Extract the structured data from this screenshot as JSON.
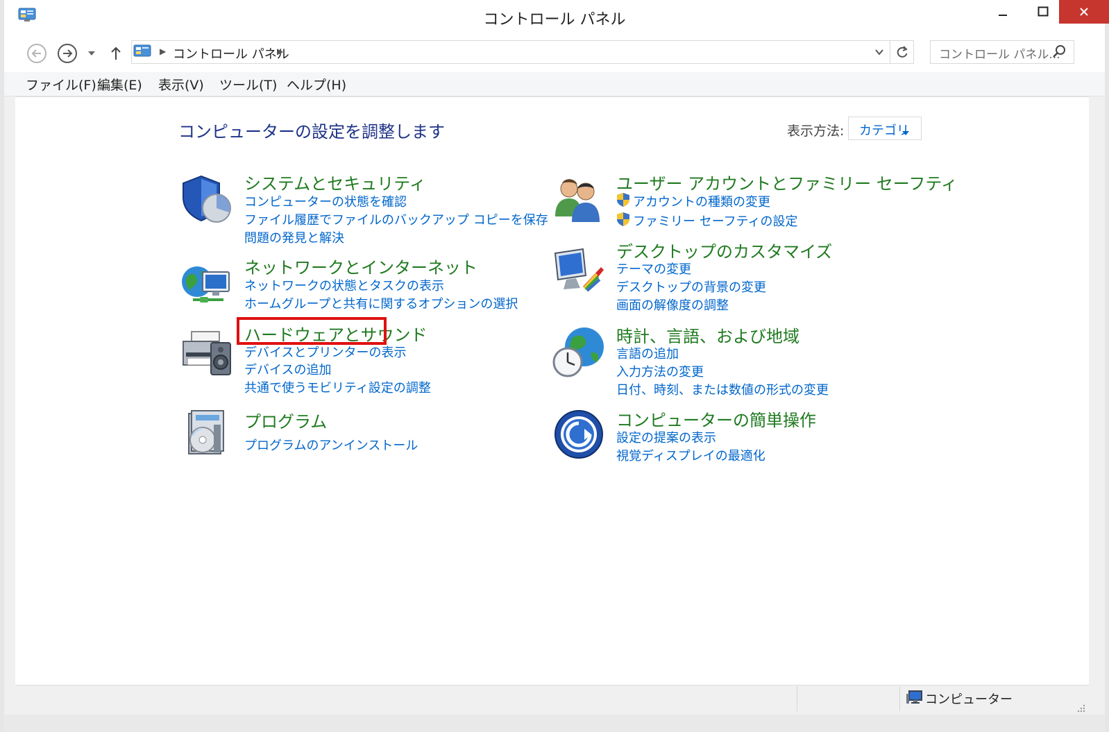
{
  "window": {
    "title": "コントロール パネル",
    "accent_close": "#c7352f"
  },
  "nav": {
    "breadcrumb": "コントロール パネル",
    "search_placeholder": "コントロール パネル..."
  },
  "menu": {
    "items": [
      "ファイル(F)",
      "編集(E)",
      "表示(V)",
      "ツール(T)",
      "ヘルプ(H)"
    ]
  },
  "main": {
    "heading": "コンピューターの設定を調整します",
    "view_by_label": "表示方法:",
    "view_by_value": "カテゴリ",
    "categories": [
      {
        "title": "システムとセキュリティ",
        "icon": "shield-icon",
        "links": [
          "コンピューターの状態を確認",
          "ファイル履歴でファイルのバックアップ コピーを保存",
          "問題の発見と解決"
        ]
      },
      {
        "title": "ネットワークとインターネット",
        "icon": "network-icon",
        "links": [
          "ネットワークの状態とタスクの表示",
          "ホームグループと共有に関するオプションの選択"
        ]
      },
      {
        "title": "ハードウェアとサウンド",
        "icon": "printer-icon",
        "links": [
          "デバイスとプリンターの表示",
          "デバイスの追加",
          "共通で使うモビリティ設定の調整"
        ]
      },
      {
        "title": "プログラム",
        "icon": "programs-icon",
        "links": [
          "プログラムのアンインストール"
        ]
      },
      {
        "title": "ユーザー アカウントとファミリー セーフティ",
        "icon": "users-icon",
        "links": [
          "アカウントの種類の変更",
          "ファミリー セーフティの設定"
        ]
      },
      {
        "title": "デスクトップのカスタマイズ",
        "icon": "desktop-icon",
        "links": [
          "テーマの変更",
          "デスクトップの背景の変更",
          "画面の解像度の調整"
        ]
      },
      {
        "title": "時計、言語、および地域",
        "icon": "clock-globe-icon",
        "links": [
          "言語の追加",
          "入力方法の変更",
          "日付、時刻、または数値の形式の変更"
        ]
      },
      {
        "title": "コンピューターの簡単操作",
        "icon": "ease-of-access-icon",
        "links": [
          "設定の提案の表示",
          "視覚ディスプレイの最適化"
        ]
      }
    ],
    "highlight_color": "#e01010"
  },
  "status": {
    "text": "コンピューター"
  },
  "colors": {
    "link": "#0066cc",
    "category_title": "#1f7a1f",
    "heading": "#1e3287"
  }
}
